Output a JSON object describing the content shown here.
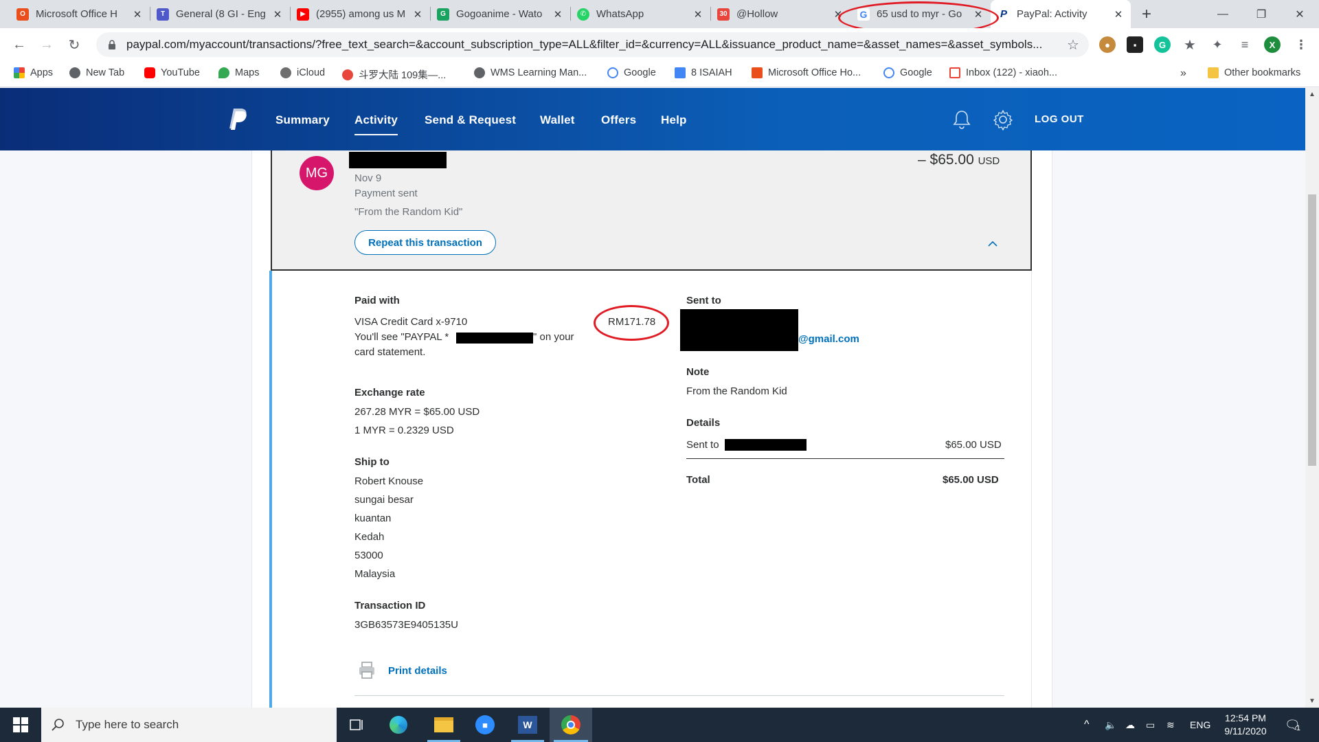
{
  "browser": {
    "tabs": [
      {
        "title": "Microsoft Office H",
        "icon": "office-icon",
        "color": "#e94e1b"
      },
      {
        "title": "General (8 GI - Eng",
        "icon": "teams-icon",
        "color": "#5059c9"
      },
      {
        "title": "(2955) among us M",
        "icon": "youtube-icon",
        "color": "#ff0000"
      },
      {
        "title": "Gogoanime - Wato",
        "icon": "gogoanime-icon",
        "color": "#1aa260"
      },
      {
        "title": "WhatsApp",
        "icon": "whatsapp-icon",
        "color": "#25d366"
      },
      {
        "title": "@Hollow",
        "icon": "calendar-icon",
        "color": "#e8453c",
        "badge": "30"
      },
      {
        "title": "65 usd to myr - Go",
        "icon": "google-icon",
        "color": "#4285f4"
      },
      {
        "title": "PayPal: Activity",
        "icon": "paypal-icon",
        "color": "#003087"
      }
    ],
    "url": "paypal.com/myaccount/transactions/?free_text_search=&account_subscription_type=ALL&filter_id=&currency=ALL&issuance_product_name=&asset_names=&asset_symbols...",
    "profile_initial": "X",
    "bookmarks": [
      {
        "label": "Apps"
      },
      {
        "label": "New Tab"
      },
      {
        "label": "YouTube"
      },
      {
        "label": "Maps"
      },
      {
        "label": "iCloud"
      },
      {
        "label": "斗罗大陆 109集—..."
      },
      {
        "label": "WMS Learning Man..."
      },
      {
        "label": "Google"
      },
      {
        "label": "8 ISAIAH"
      },
      {
        "label": "Microsoft Office Ho..."
      },
      {
        "label": "Google"
      },
      {
        "label": "Inbox (122) - xiaoh..."
      }
    ],
    "bookmarks_overflow": "»",
    "other_bookmarks": "Other bookmarks"
  },
  "paypal": {
    "nav": {
      "summary": "Summary",
      "activity": "Activity",
      "send_request": "Send & Request",
      "wallet": "Wallet",
      "offers": "Offers",
      "help": "Help",
      "logout": "LOG OUT"
    },
    "transaction": {
      "avatar_initials": "MG",
      "date": "Nov 9",
      "type": "Payment sent",
      "memo": "\"From the Random Kid\"",
      "amount": "– $65.00",
      "amount_currency": "USD",
      "repeat_label": "Repeat this transaction"
    },
    "details": {
      "paid_with_label": "Paid with",
      "card": "VISA Credit Card x-9710",
      "statement_prefix": "You'll see \"PAYPAL *",
      "statement_suffix": "\" on your",
      "statement_line2": "card statement.",
      "annotation_amount": "RM171.78",
      "exchange_label": "Exchange rate",
      "exchange_line1": "267.28 MYR = $65.00 USD",
      "exchange_line2": "1 MYR = 0.2329 USD",
      "ship_label": "Ship to",
      "ship_lines": [
        "Robert Knouse",
        "sungai besar",
        "kuantan",
        "Kedah",
        "53000",
        "Malaysia"
      ],
      "txn_id_label": "Transaction ID",
      "txn_id": "3GB63573E9405135U",
      "print_label": "Print details",
      "sent_to_label": "Sent to",
      "email_suffix": "@gmail.com",
      "note_label": "Note",
      "note": "From the Random Kid",
      "details_label": "Details",
      "details_sent_to": "Sent to",
      "details_amount": "$65.00 USD",
      "total_label": "Total",
      "total_amount": "$65.00 USD"
    }
  },
  "taskbar": {
    "search_placeholder": "Type here to search",
    "language": "ENG",
    "time": "12:54 PM",
    "date": "9/11/2020",
    "notification_count": "1"
  }
}
